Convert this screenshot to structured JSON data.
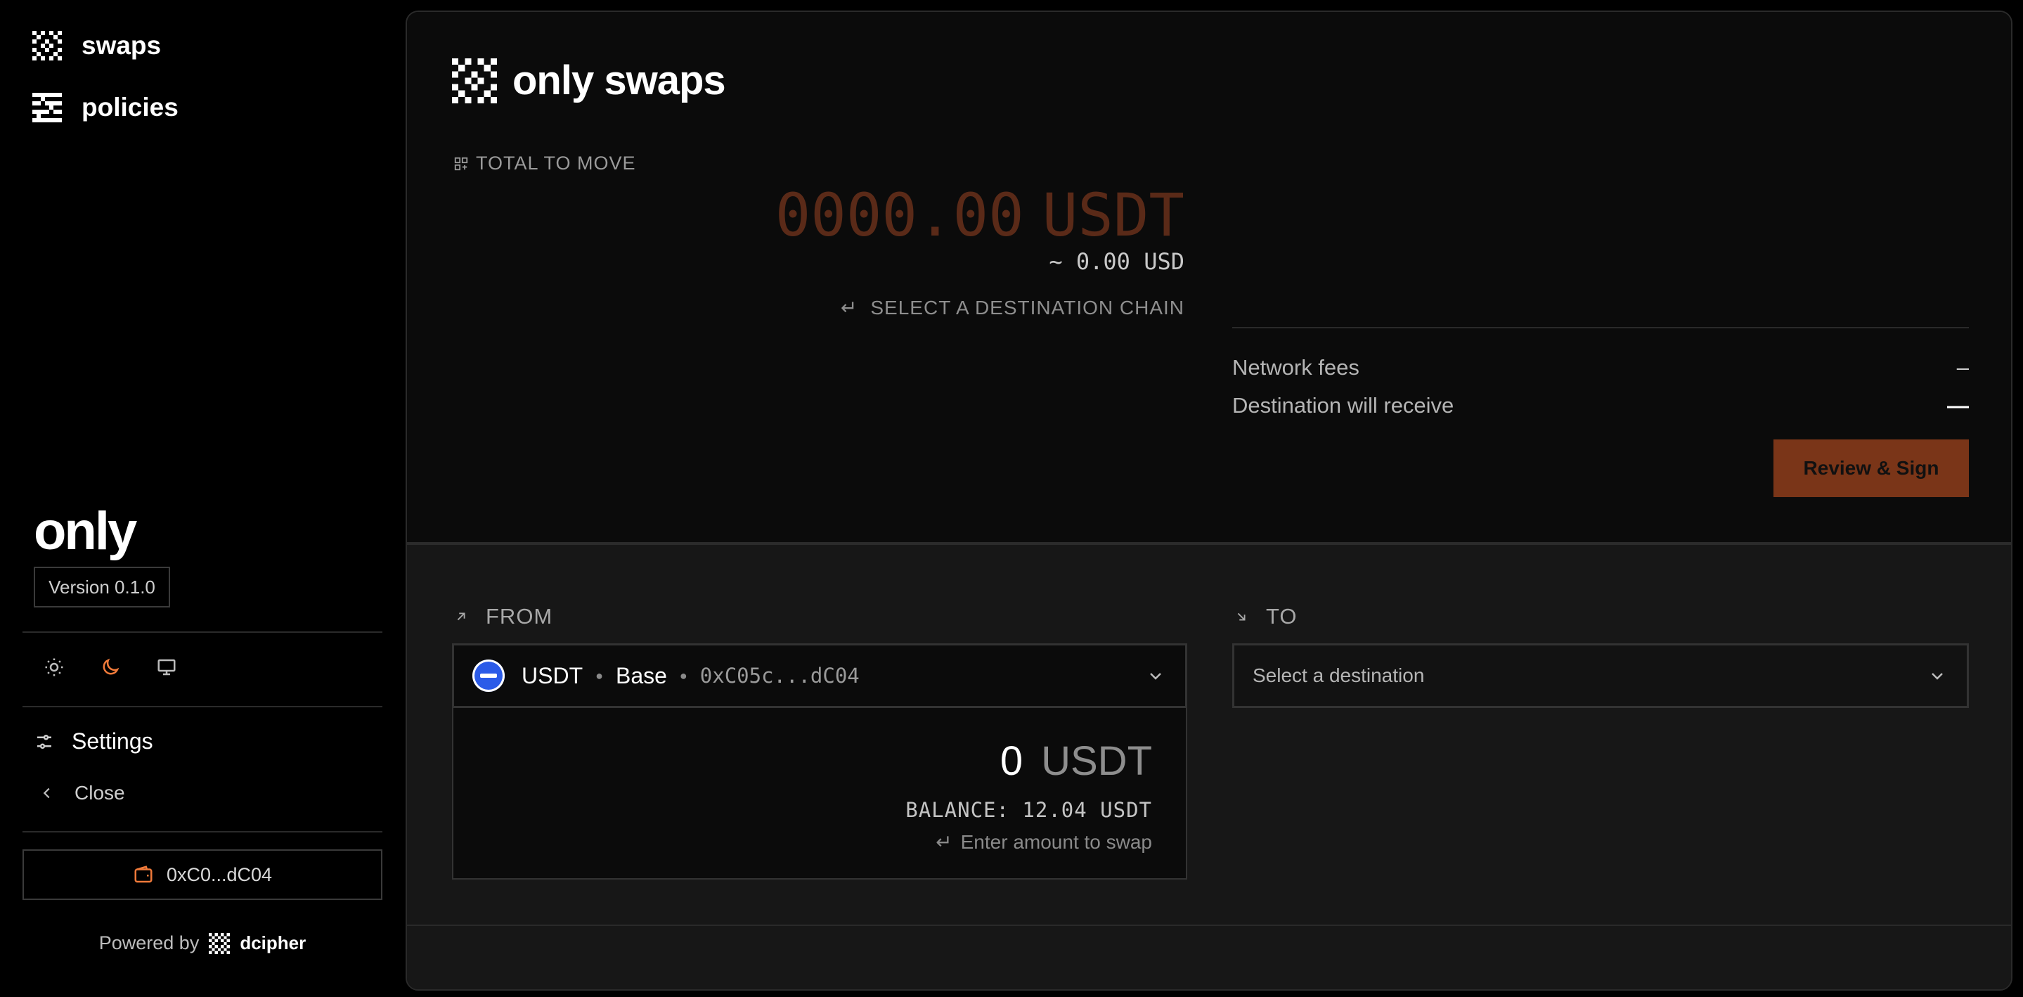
{
  "sidebar": {
    "nav": [
      {
        "label": "swaps",
        "icon": "swaps-grid-icon"
      },
      {
        "label": "policies",
        "icon": "policies-icon"
      }
    ],
    "brand": "only",
    "version": "Version 0.1.0",
    "theme_options": [
      "light-theme-icon",
      "dark-theme-icon",
      "system-theme-icon"
    ],
    "selected_theme": "dark",
    "settings_label": "Settings",
    "close_label": "Close",
    "wallet_address": "0xC0...dC04",
    "powered_by_label": "Powered by",
    "powered_by_brand": "dcipher"
  },
  "main": {
    "title": "only swaps",
    "total_label": "TOTAL TO MOVE",
    "total_amount": "0000.00",
    "total_currency": "USDT",
    "usd_estimate": "~ 0.00 USD",
    "destination_hint": "SELECT A DESTINATION CHAIN",
    "fees": [
      {
        "label": "Network fees",
        "value": "–"
      },
      {
        "label": "Destination will receive",
        "value": "—"
      }
    ],
    "review_button": "Review & Sign",
    "from": {
      "label": "FROM",
      "token": "USDT",
      "chain": "Base",
      "address": "0xC05c...dC04",
      "amount": "0",
      "currency": "USDT",
      "balance": "BALANCE: 12.04 USDT",
      "hint": "Enter amount to swap"
    },
    "to": {
      "label": "TO",
      "placeholder": "Select a destination"
    }
  },
  "colors": {
    "accent": "#f07a3a",
    "review_bg": "#7a3518",
    "amount_placeholder": "#5a2a18",
    "token_blue": "#2b5be8"
  }
}
